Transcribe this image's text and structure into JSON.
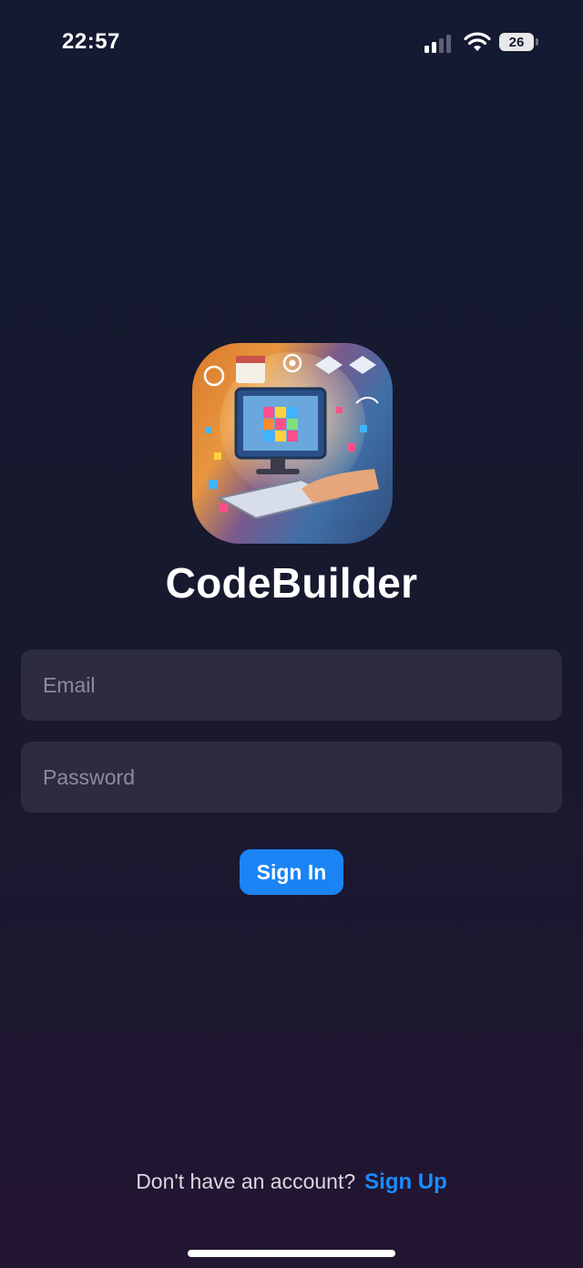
{
  "status_bar": {
    "time": "22:57",
    "battery": "26",
    "icons": [
      "signal-icon",
      "wifi-icon",
      "battery-icon"
    ]
  },
  "app": {
    "name": "CodeBuilder",
    "logo_icon": "app-logo-icon"
  },
  "form": {
    "email_placeholder": "Email",
    "password_placeholder": "Password",
    "sign_in_label": "Sign In"
  },
  "footer": {
    "prompt": "Don't have an account?",
    "sign_up_label": "Sign Up"
  },
  "colors": {
    "accent": "#1a84f5",
    "link": "#1a8cff",
    "field_background": "#2c2b42",
    "background_top": "#141a31",
    "background_bottom": "#231632"
  }
}
